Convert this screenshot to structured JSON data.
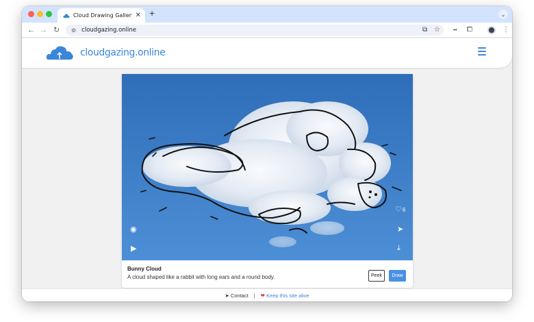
{
  "browser": {
    "tab_title": "Cloud Drawing Gallery - Crea",
    "url": "cloudgazing.online",
    "icons": [
      "back-arrow",
      "forward-arrow",
      "reload",
      "site-settings",
      "cast",
      "bookmark-star",
      "extension-dots",
      "puzzle",
      "profile-avatar",
      "kebab-menu"
    ]
  },
  "site": {
    "name": "cloudgazing.online",
    "brand_color": "#3b86d9"
  },
  "drawing": {
    "title": "Bunny Cloud",
    "description": "A cloud shaped like a rabbit with long ears and a round body.",
    "likes": "6",
    "peek_label": "Peek",
    "draw_label": "Draw"
  },
  "footer": {
    "contact_label": "Contact",
    "separator": "|",
    "support_label": "Keep this site alive"
  },
  "colors": {
    "sky": "#3f7fc8",
    "button_blue": "#4a90e2",
    "heart_red": "#e53935"
  }
}
